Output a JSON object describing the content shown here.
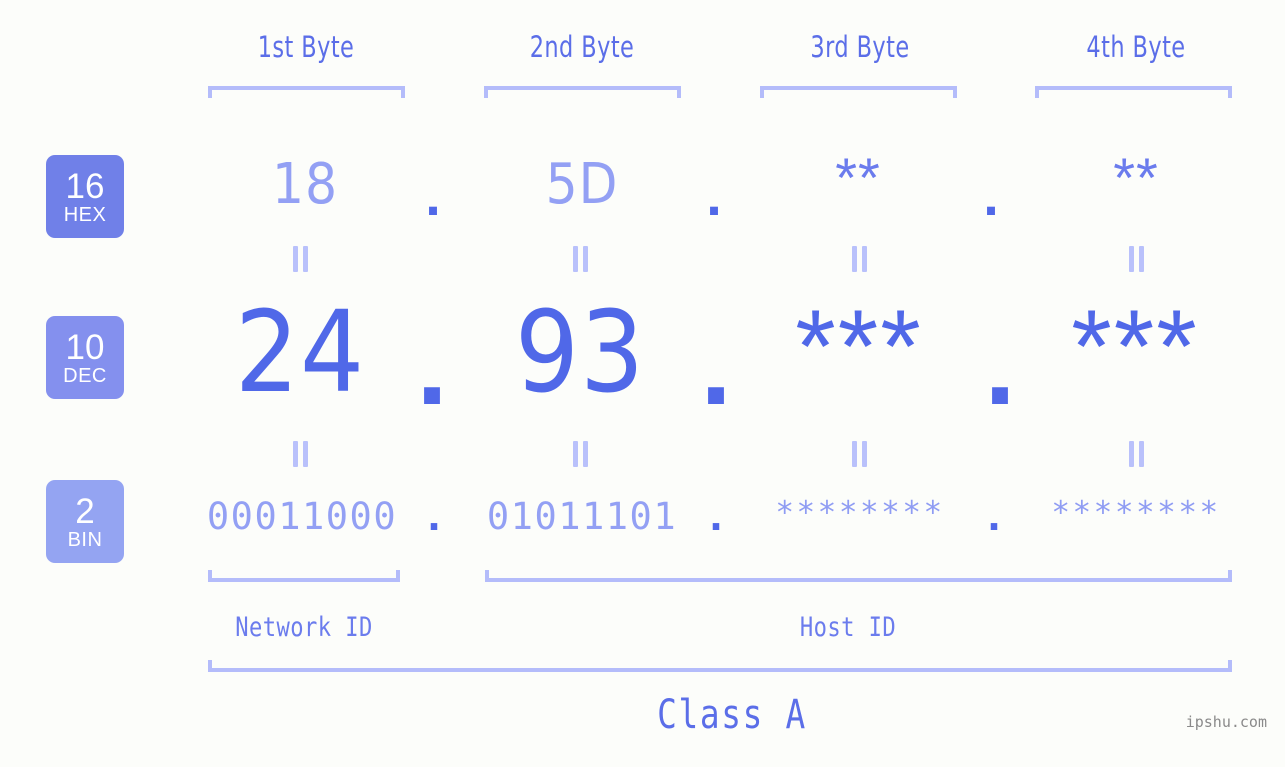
{
  "meta": {
    "background_color": "#fcfdfa",
    "accent_strong": "#5068e8",
    "accent_mid": "#6b7ced",
    "accent_light": "#93a0f4",
    "bracket_color": "#b4bcfa",
    "watermark": "ipshu.com"
  },
  "byte_headers": [
    {
      "label": "1st Byte"
    },
    {
      "label": "2nd Byte"
    },
    {
      "label": "3rd Byte"
    },
    {
      "label": "4th Byte"
    }
  ],
  "bases": [
    {
      "number": "16",
      "name": "HEX",
      "color": "#7080e8"
    },
    {
      "number": "10",
      "name": "DEC",
      "color": "#8490ee"
    },
    {
      "number": "2",
      "name": "BIN",
      "color": "#94a4f2"
    }
  ],
  "rows": {
    "hex": {
      "values": [
        "18",
        "5D",
        "**",
        "**"
      ],
      "separators": [
        ".",
        ".",
        "."
      ]
    },
    "dec": {
      "values": [
        "24",
        "93",
        "***",
        "***"
      ],
      "separators": [
        ".",
        ".",
        "."
      ]
    },
    "bin": {
      "values": [
        "00011000",
        "01011101",
        "********",
        "********"
      ],
      "separators": [
        ".",
        ".",
        "."
      ]
    }
  },
  "connectors": {
    "glyph": "=",
    "rows": [
      "hex-to-dec",
      "dec-to-bin"
    ]
  },
  "sections": [
    {
      "label": "Network ID"
    },
    {
      "label": "Host ID"
    }
  ],
  "class": {
    "label": "Class A"
  }
}
